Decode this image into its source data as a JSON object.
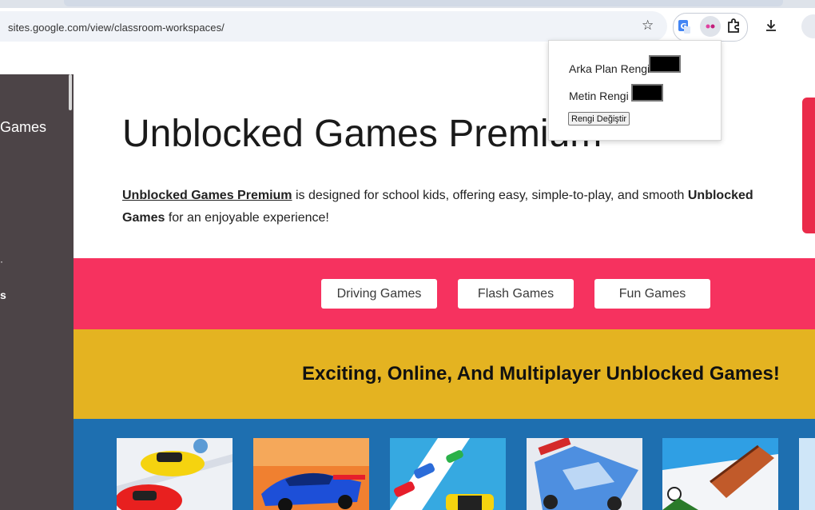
{
  "browser": {
    "url": "sites.google.com/view/classroom-workspaces/",
    "icons": [
      "star-icon",
      "translate-extension-icon",
      "color-extension-icon",
      "extensions-puzzle-icon",
      "download-icon"
    ]
  },
  "popup": {
    "bg_label": "Arka Plan Rengi",
    "text_label": "Metin Rengi",
    "button_label": "Rengi Değiştir",
    "bg_value": "#000000",
    "text_value": "#000000"
  },
  "sidebar": {
    "games_label": "Games",
    "tick_a": "·",
    "tick_b": "s"
  },
  "hero": {
    "title": "Unblocked Games Premium",
    "desc_link": "Unblocked Games Premium",
    "desc_mid": " is designed for school kids, offering easy, simple-to-play, and smooth ",
    "desc_bold": "Unblocked Games",
    "desc_end": " for an enjoyable experience!"
  },
  "categories": [
    "Driving Games",
    "Flash Games",
    "Fun Games"
  ],
  "section_heading": "Exciting, Online, And Multiplayer Unblocked Games!",
  "colors": {
    "pink_band": "#f6325f",
    "yellow_band": "#e4b321",
    "blue_band": "#1e6fb0",
    "sidebar": "#4c4447"
  }
}
